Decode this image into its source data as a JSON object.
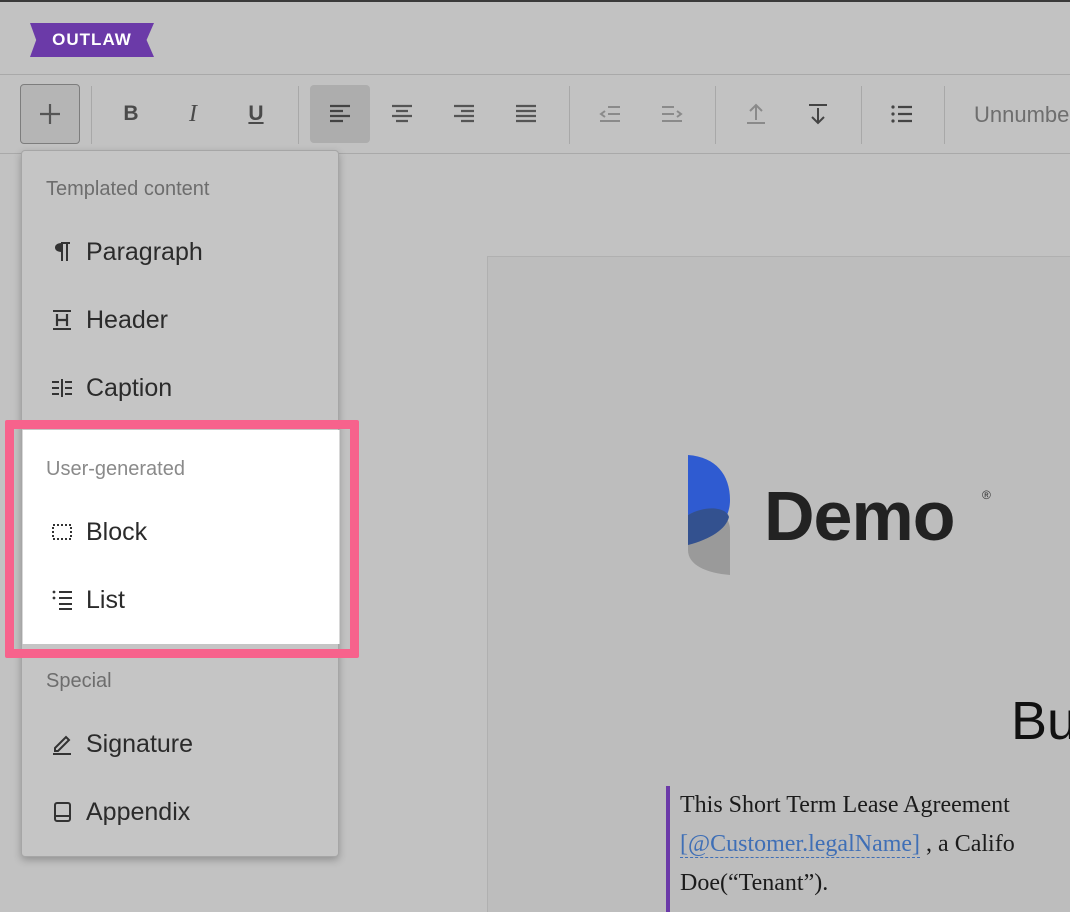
{
  "app": {
    "logo_text": "OUTLAW",
    "brand_color": "#6b3aa8"
  },
  "toolbar": {
    "add_label": "+",
    "bold_label": "B",
    "italic_label": "I",
    "underline_label": "U",
    "list_style_text": "Unnumbe"
  },
  "menu": {
    "sections": [
      {
        "title": "Templated content",
        "items": [
          {
            "label": "Paragraph",
            "icon": "pilcrow-icon"
          },
          {
            "label": "Header",
            "icon": "header-icon"
          },
          {
            "label": "Caption",
            "icon": "caption-icon"
          }
        ]
      },
      {
        "title": "User-generated",
        "items": [
          {
            "label": "Block",
            "icon": "dotted-block-icon"
          },
          {
            "label": "List",
            "icon": "list-icon"
          }
        ]
      },
      {
        "title": "Special",
        "items": [
          {
            "label": "Signature",
            "icon": "pen-icon"
          },
          {
            "label": "Appendix",
            "icon": "book-icon"
          }
        ]
      }
    ],
    "highlight_color": "#f7628c"
  },
  "document": {
    "logo_text": "Demo",
    "logo_reg": "®",
    "heading_partial": "Bu",
    "paragraph": {
      "line1": "This Short Term Lease Agreement",
      "field": "[@Customer.legalName]",
      "line2_after": " , a Califo",
      "line3": "Doe(“Tenant”)."
    }
  }
}
